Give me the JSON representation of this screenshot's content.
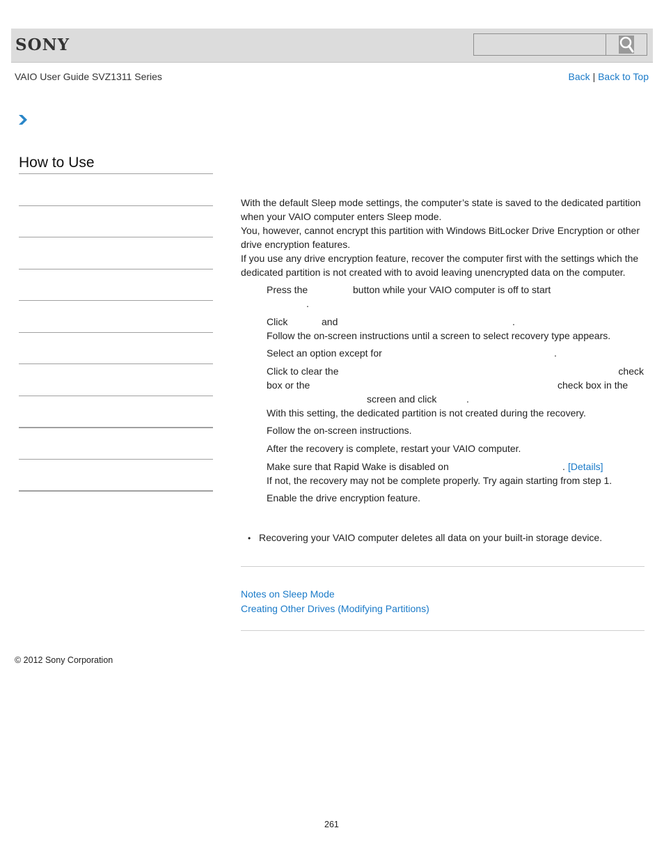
{
  "header": {
    "brand": "SONY",
    "search": {
      "value": "",
      "placeholder": ""
    },
    "search_icon": "search-icon"
  },
  "subheader": {
    "guide_title": "VAIO User Guide SVZ1311 Series",
    "back_label": "Back",
    "separator": "|",
    "back_to_top_label": "Back to Top"
  },
  "breadcrumb_icon": "chevron-right-icon",
  "sidebar": {
    "heading": "How to Use",
    "items": [
      {
        "label": ""
      },
      {
        "label": ""
      },
      {
        "label": ""
      },
      {
        "label": ""
      },
      {
        "label": ""
      },
      {
        "label": ""
      },
      {
        "label": ""
      },
      {
        "label": ""
      },
      {
        "label": ""
      },
      {
        "label": ""
      }
    ]
  },
  "intro": {
    "p1": "With the default Sleep mode settings, the computer’s state is saved to the dedicated partition when your VAIO computer enters Sleep mode.",
    "p2": "You, however, cannot encrypt this partition with Windows BitLocker Drive Encryption or other drive encryption features.",
    "p3": "If you use any drive encryption feature, recover the computer first with the settings which the dedicated partition is not created with to avoid leaving unencrypted data on the computer."
  },
  "steps": [
    {
      "line1a": "Press the",
      "line1b": "button while your VAIO computer is off to start",
      "line2": "."
    },
    {
      "line1a": "Click",
      "line1b": "and",
      "line1c": ".",
      "line2": "Follow the on-screen instructions until a screen to select recovery type appears."
    },
    {
      "line1a": "Select an option except for",
      "line1b": "."
    },
    {
      "line1a": "Click to clear the",
      "line1b": "check",
      "line2a": "box or the",
      "line2b": "check box in the",
      "line3a": "screen and click",
      "line3b": ".",
      "line4": "With this setting, the dedicated partition is not created during the recovery."
    },
    {
      "line1": "Follow the on-screen instructions."
    },
    {
      "line1": "After the recovery is complete, restart your VAIO computer."
    },
    {
      "line1a": "Make sure that Rapid Wake is disabled on",
      "line1b": ".",
      "details_link": "[Details]",
      "line2": "If not, the recovery may not be complete properly. Try again starting from step 1."
    },
    {
      "line1": "Enable the drive encryption feature."
    }
  ],
  "note": {
    "bullet": "•",
    "text": "Recovering your VAIO computer deletes all data on your built-in storage device."
  },
  "related": [
    {
      "label": "Notes on Sleep Mode"
    },
    {
      "label": "Creating Other Drives (Modifying Partitions)"
    }
  ],
  "footer": {
    "copyright": "© 2012 Sony Corporation",
    "page_number": "261"
  }
}
